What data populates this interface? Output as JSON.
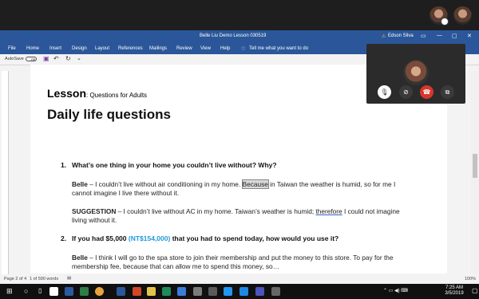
{
  "window": {
    "title": "Belle Liu Demo Lesson 030519",
    "user": "Edson Silva",
    "min": "—",
    "max": "▢",
    "close": "✕",
    "ribbon_opts": "▭"
  },
  "ribbon": {
    "tabs": [
      "File",
      "Home",
      "Insert",
      "Design",
      "Layout",
      "References",
      "Mailings",
      "Review",
      "View",
      "Help"
    ],
    "tell_me": "Tell me what you want to do"
  },
  "qat": {
    "autosave": "AutoSave",
    "toggle": "Off"
  },
  "doc": {
    "lesson_title": "Lesson",
    "lesson_sub": ": Questions for Adults",
    "heading": "Daily life questions",
    "q1_num": "1.",
    "q1": "What’s one thing in your home you couldn’t live without? Why?",
    "a1_name": "Belle",
    "a1_pre": " – I couldn’t live without air conditioning in my home. ",
    "a1_hl": "Because",
    "a1_post": " in Taiwan the weather is humid, so for me I cannot imagine I live there without it.",
    "s1_name": "SUGGESTION",
    "s1_pre": " – I couldn’t live without AC in my home. Taiwan’s weather is humid; ",
    "s1_ul": "therefore",
    "s1_post": " I could not imagine living without it.",
    "q2_num": "2.",
    "q2_pre": "If you had $5,000 ",
    "q2_blue": "(NT$154,000)",
    "q2_post": " that you had to spend today, how would you use it?",
    "a2_name": "Belle",
    "a2_text": " – I think I will go to the spa store to join their membership and put the money to this store. To pay for the membership fee, because that can allow me to spend this money, so…"
  },
  "status": {
    "page": "Page 2 of 4",
    "words": "1 of 590 words",
    "zoom": "100%"
  },
  "taskbar": {
    "time": "7:25 AM",
    "date": "3/5/2019"
  },
  "call": {
    "mic_icon": "mic-icon",
    "cam_icon": "camera-off-icon",
    "end_icon": "end-call-icon",
    "share_icon": "share-screen-icon"
  }
}
